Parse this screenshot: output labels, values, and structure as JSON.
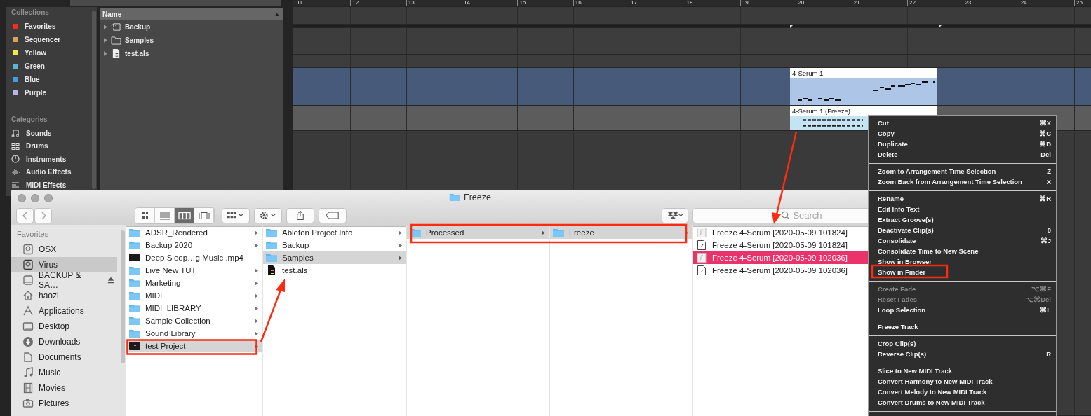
{
  "browser": {
    "collections_heading": "Collections",
    "collections": [
      {
        "label": "Favorites",
        "color": "#ff2a1a"
      },
      {
        "label": "Sequencer",
        "color": "#d9a35a"
      },
      {
        "label": "Yellow",
        "color": "#f5e642"
      },
      {
        "label": "Green",
        "color": "#5fb4d6"
      },
      {
        "label": "Blue",
        "color": "#3f9fe0"
      },
      {
        "label": "Purple",
        "color": "#b8b5e8"
      }
    ],
    "categories_heading": "Categories",
    "categories": [
      {
        "label": "Sounds"
      },
      {
        "label": "Drums"
      },
      {
        "label": "Instruments"
      },
      {
        "label": "Audio Effects"
      },
      {
        "label": "MIDI Effects"
      }
    ],
    "name_header": "Name",
    "sort_indicator": "▲",
    "files": [
      {
        "name": "Backup",
        "kind": "backup"
      },
      {
        "name": "Samples",
        "kind": "folder"
      },
      {
        "name": "test.als",
        "kind": "als"
      }
    ]
  },
  "arrangement": {
    "ruler": [
      "11",
      "12",
      "13",
      "14",
      "15",
      "16",
      "17",
      "18",
      "19",
      "20",
      "21",
      "22",
      "23",
      "24",
      "25"
    ],
    "clips": [
      {
        "title": "4-Serum 1",
        "kind": "midi"
      },
      {
        "title": "4-Serum 1 (Freeze)",
        "kind": "audio"
      }
    ]
  },
  "finder": {
    "title": "Freeze",
    "view_modes": [
      {
        "selected": false
      },
      {
        "selected": false
      },
      {
        "selected": true
      },
      {
        "selected": false
      }
    ],
    "search": {
      "placeholder": "Search"
    },
    "sidebar": {
      "heading": "Favorites",
      "items": [
        {
          "label": "OSX",
          "selected": false,
          "ejectable": false
        },
        {
          "label": "Virus",
          "selected": true,
          "ejectable": false
        },
        {
          "label": "BACKUP & SA…",
          "selected": false,
          "ejectable": true
        },
        {
          "label": "haozi",
          "selected": false,
          "ejectable": false
        },
        {
          "label": "Applications",
          "selected": false,
          "ejectable": false
        },
        {
          "label": "Desktop",
          "selected": false,
          "ejectable": false
        },
        {
          "label": "Downloads",
          "selected": false,
          "ejectable": false
        },
        {
          "label": "Documents",
          "selected": false,
          "ejectable": false
        },
        {
          "label": "Music",
          "selected": false,
          "ejectable": false
        },
        {
          "label": "Movies",
          "selected": false,
          "ejectable": false
        },
        {
          "label": "Pictures",
          "selected": false,
          "ejectable": false
        }
      ]
    },
    "columns": [
      {
        "focused": false,
        "items": [
          {
            "name": "ADSR_Rendered",
            "kind": "folder",
            "selected": false,
            "has_children": true
          },
          {
            "name": "Backup 2020",
            "kind": "folder",
            "selected": false,
            "has_children": true
          },
          {
            "name": "Deep Sleep…g Music .mp4",
            "kind": "video",
            "selected": false,
            "has_children": false
          },
          {
            "name": "Live New TUT",
            "kind": "folder",
            "selected": false,
            "has_children": true
          },
          {
            "name": "Marketing",
            "kind": "folder",
            "selected": false,
            "has_children": true
          },
          {
            "name": "MIDI",
            "kind": "folder",
            "selected": false,
            "has_children": true
          },
          {
            "name": "MIDI_LIBRARY",
            "kind": "folder",
            "selected": false,
            "has_children": true
          },
          {
            "name": "Sample Collection",
            "kind": "folder",
            "selected": false,
            "has_children": true
          },
          {
            "name": "Sound Library",
            "kind": "folder",
            "selected": false,
            "has_children": true
          },
          {
            "name": "test Project",
            "kind": "project",
            "selected": true,
            "has_children": true
          }
        ]
      },
      {
        "focused": false,
        "items": [
          {
            "name": "Ableton Project Info",
            "kind": "folder",
            "selected": false,
            "has_children": true
          },
          {
            "name": "Backup",
            "kind": "folder",
            "selected": false,
            "has_children": true
          },
          {
            "name": "Samples",
            "kind": "folder",
            "selected": true,
            "has_children": true
          },
          {
            "name": "test.als",
            "kind": "als",
            "selected": false,
            "has_children": false
          }
        ]
      },
      {
        "focused": false,
        "items": [
          {
            "name": "Processed",
            "kind": "folder",
            "selected": true,
            "has_children": true
          }
        ]
      },
      {
        "focused": false,
        "items": [
          {
            "name": "Freeze",
            "kind": "folder",
            "selected": true,
            "has_children": true
          }
        ]
      },
      {
        "focused": true,
        "items": [
          {
            "name": "Freeze 4-Serum [2020-05-09 101824]",
            "kind": "audio",
            "selected": false,
            "has_children": false
          },
          {
            "name": "Freeze 4-Serum [2020-05-09 101824]",
            "kind": "document",
            "selected": false,
            "has_children": false
          },
          {
            "name": "Freeze 4-Serum [2020-05-09 102036]",
            "kind": "audio",
            "selected": true,
            "has_children": false
          },
          {
            "name": "Freeze 4-Serum [2020-05-09 102036]",
            "kind": "document",
            "selected": false,
            "has_children": false
          }
        ]
      }
    ]
  },
  "context_menu": {
    "sections": [
      [
        {
          "label": "Cut",
          "shortcut": "⌘X",
          "disabled": false
        },
        {
          "label": "Copy",
          "shortcut": "⌘C",
          "disabled": false
        },
        {
          "label": "Duplicate",
          "shortcut": "⌘D",
          "disabled": false
        },
        {
          "label": "Delete",
          "shortcut": "Del",
          "disabled": false
        }
      ],
      [
        {
          "label": "Zoom to Arrangement Time Selection",
          "shortcut": "Z",
          "disabled": false
        },
        {
          "label": "Zoom Back from Arrangement Time Selection",
          "shortcut": "X",
          "disabled": false
        }
      ],
      [
        {
          "label": "Rename",
          "shortcut": "⌘R",
          "disabled": false
        },
        {
          "label": "Edit Info Text",
          "disabled": false
        },
        {
          "label": "Extract Groove(s)",
          "disabled": false
        },
        {
          "label": "Deactivate Clip(s)",
          "shortcut": "0",
          "disabled": false
        },
        {
          "label": "Consolidate",
          "shortcut": "⌘J",
          "disabled": false
        },
        {
          "label": "Consolidate Time to New Scene",
          "disabled": false
        },
        {
          "label": "Show in Browser",
          "disabled": false
        },
        {
          "label": "Show in Finder",
          "disabled": false
        }
      ],
      [
        {
          "label": "Create Fade",
          "shortcut": "⌥⌘F",
          "disabled": true
        },
        {
          "label": "Reset Fades",
          "shortcut": "⌥⌘Del",
          "disabled": true
        },
        {
          "label": "Loop Selection",
          "shortcut": "⌘L",
          "disabled": false
        }
      ],
      [
        {
          "label": "Freeze Track",
          "disabled": false
        }
      ],
      [
        {
          "label": "Crop Clip(s)",
          "disabled": false
        },
        {
          "label": "Reverse Clip(s)",
          "shortcut": "R",
          "disabled": false
        }
      ],
      [
        {
          "label": "Slice to New MIDI Track",
          "disabled": false
        },
        {
          "label": "Convert Harmony to New MIDI Track",
          "disabled": false
        },
        {
          "label": "Convert Melody to New MIDI Track",
          "disabled": false
        },
        {
          "label": "Convert Drums to New MIDI Track",
          "disabled": false
        }
      ]
    ]
  }
}
